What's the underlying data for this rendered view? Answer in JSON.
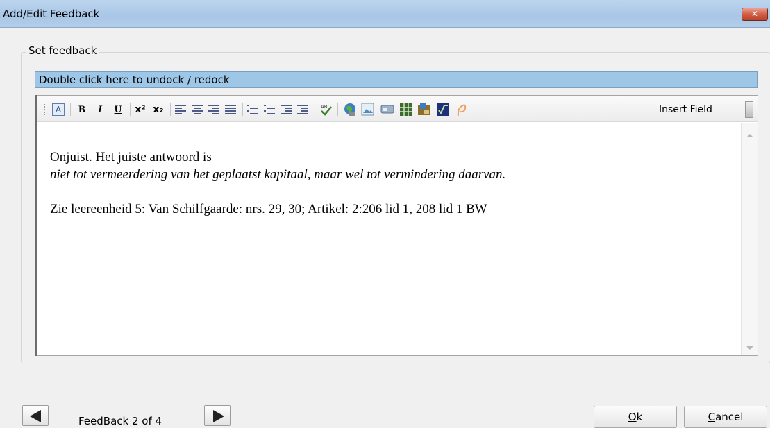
{
  "window": {
    "title": "Add/Edit Feedback",
    "close_glyph": "✕"
  },
  "group": {
    "legend": "Set feedback"
  },
  "dock": {
    "label": "Double click here to undock / redock"
  },
  "toolbar": {
    "font_box": "A",
    "bold": "B",
    "italic": "I",
    "underline": "U",
    "superscript": "x²",
    "subscript": "x₂",
    "insert_field": "Insert Field",
    "icons": [
      "font-box-icon",
      "bold-icon",
      "italic-icon",
      "underline-icon",
      "superscript-icon",
      "subscript-icon",
      "align-left-icon",
      "align-center-icon",
      "align-right-icon",
      "justify-icon",
      "numbered-list-icon",
      "bullet-list-icon",
      "outdent-icon",
      "indent-icon",
      "spellcheck-icon",
      "hyperlink-icon",
      "image-icon",
      "media-icon",
      "table-icon",
      "form-icon",
      "formula-icon",
      "highlight-icon"
    ]
  },
  "editor": {
    "line1": "Onjuist. Het juiste antwoord is",
    "line2": "niet tot vermeerdering van het geplaatst kapitaal, maar wel tot vermindering daarvan.",
    "line3": "Zie leereenheid 5: Van Schilfgaarde: nrs. 29, 30; Artikel: 2:206 lid 1, 208 lid 1 BW"
  },
  "nav": {
    "label": "FeedBack 2 of 4"
  },
  "buttons": {
    "ok_mnemonic": "O",
    "ok_rest": "k",
    "cancel_mnemonic": "C",
    "cancel_rest": "ancel"
  }
}
